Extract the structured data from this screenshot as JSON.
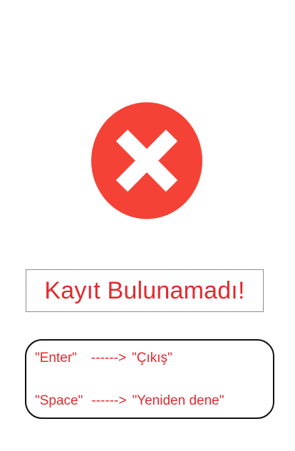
{
  "icon": {
    "name": "error-x-icon",
    "circle_color": "#f44336",
    "cross_color": "#ffffff"
  },
  "message": {
    "text": "Kayıt Bulunamadı!",
    "color": "#e12a2f"
  },
  "hints": [
    {
      "key": "\"Enter\"",
      "arrow": "------>",
      "action": "\"Çıkış\""
    },
    {
      "key": "\"Space\"",
      "arrow": "------>",
      "action": "\"Yeniden dene\""
    }
  ]
}
